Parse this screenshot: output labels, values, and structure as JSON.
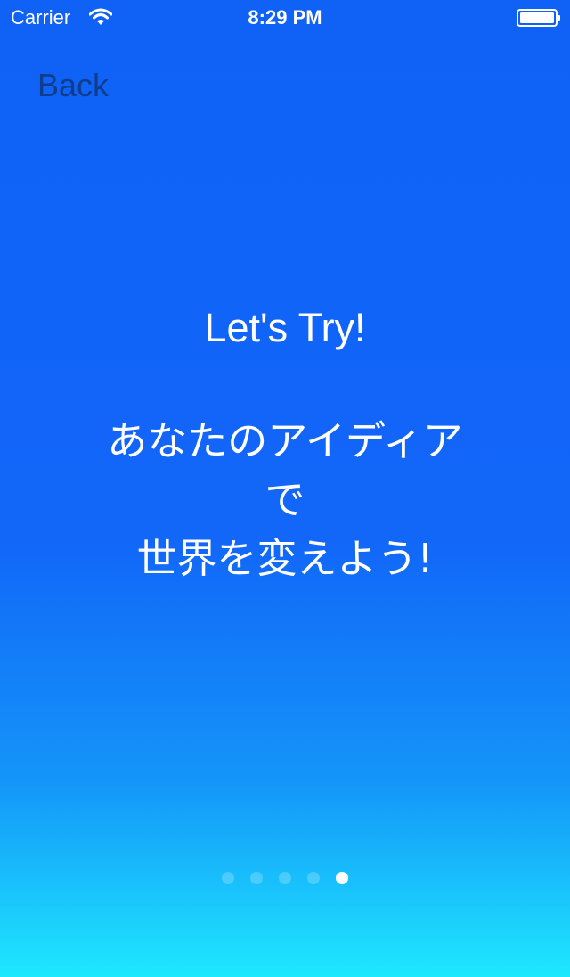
{
  "status_bar": {
    "carrier": "Carrier",
    "time": "8:29 PM",
    "wifi_icon": "wifi-icon",
    "battery_icon": "battery-full-icon"
  },
  "nav": {
    "back_label": "Back"
  },
  "content": {
    "headline": "Let's Try!",
    "message_lines": [
      "あなたのアイディア",
      "で",
      "世界を変えよう!"
    ]
  },
  "page_control": {
    "page_count": 5,
    "current_page": 5
  },
  "colors": {
    "background_top": "#1062f7",
    "background_bottom": "#1ee8fe",
    "back_text": "#0f3d8e",
    "text": "#ffffff"
  }
}
